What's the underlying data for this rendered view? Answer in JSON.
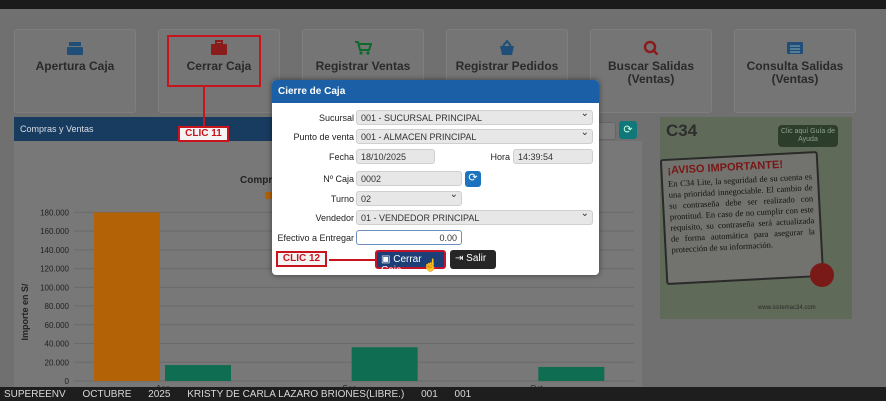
{
  "tiles": [
    {
      "label": "Apertura Caja",
      "icon": "cash-register-icon"
    },
    {
      "label": "Cerrar Caja",
      "icon": "briefcase-icon"
    },
    {
      "label": "Registrar Ventas",
      "icon": "cart-icon"
    },
    {
      "label": "Registrar Pedidos",
      "icon": "basket-icon"
    },
    {
      "label": "Buscar Salidas (Ventas)",
      "icon": "search-icon"
    },
    {
      "label": "Consulta Salidas (Ventas)",
      "icon": "list-icon"
    }
  ],
  "panel": {
    "title": "Compras y Ventas",
    "chart_subtitle": "Compra"
  },
  "chart_data": {
    "type": "bar",
    "categories": [
      "Ago",
      "Sep",
      "Oct"
    ],
    "series": [
      {
        "values": [
          180000,
          null,
          null
        ],
        "color": "#b36205"
      },
      {
        "values": [
          17000,
          36000,
          15000
        ],
        "color": "#0f6e52"
      }
    ],
    "ylabel": "Importe en S/",
    "yticks": [
      "0",
      "20.000",
      "40.000",
      "60.000",
      "80.000",
      "100.000",
      "120.000",
      "140.000",
      "160.000",
      "180.000"
    ],
    "ylim": [
      0,
      190000
    ]
  },
  "modal": {
    "title": "Cierre de Caja",
    "sucursal_label": "Sucursal",
    "sucursal_value": "001 - SUCURSAL PRINCIPAL",
    "punto_label": "Punto de venta",
    "punto_value": "001 - ALMACEN PRINCIPAL",
    "fecha_label": "Fecha",
    "fecha_value": "18/10/2025",
    "hora_label": "Hora",
    "hora_value": "14:39:54",
    "caja_label": "Nº Caja",
    "caja_value": "0002",
    "turno_label": "Turno",
    "turno_value": "02",
    "vendedor_label": "Vendedor",
    "vendedor_value": "01 - VENDEDOR PRINCIPAL",
    "efectivo_label": "Efectivo a Entregar",
    "efectivo_value": "0.00",
    "cerrar_label": "Cerrar Caja",
    "salir_label": "Salir"
  },
  "callouts": {
    "c11": "CLIC 11",
    "c12": "CLIC 12"
  },
  "notice": {
    "brand": "C34",
    "help": "Clic aquí Guía de Ayuda",
    "title": "¡AVISO IMPORTANTE!",
    "text": "En C34 Lite, la seguridad de su cuenta es una prioridad innegociable. El cambio de su contraseña debe ser realizado con prontitud. En caso de no cumplir con este requisito, su contraseña será actualizada de forma automática para asegurar la protección de su información.",
    "site": "www.sistemac34.com"
  },
  "status": {
    "company": "SUPEREENV",
    "month": "OCTUBRE",
    "year": "2025",
    "user": "KRISTY DE CARLA LAZARO BRIONES(LIBRE.)",
    "code1": "001",
    "code2": "001"
  }
}
